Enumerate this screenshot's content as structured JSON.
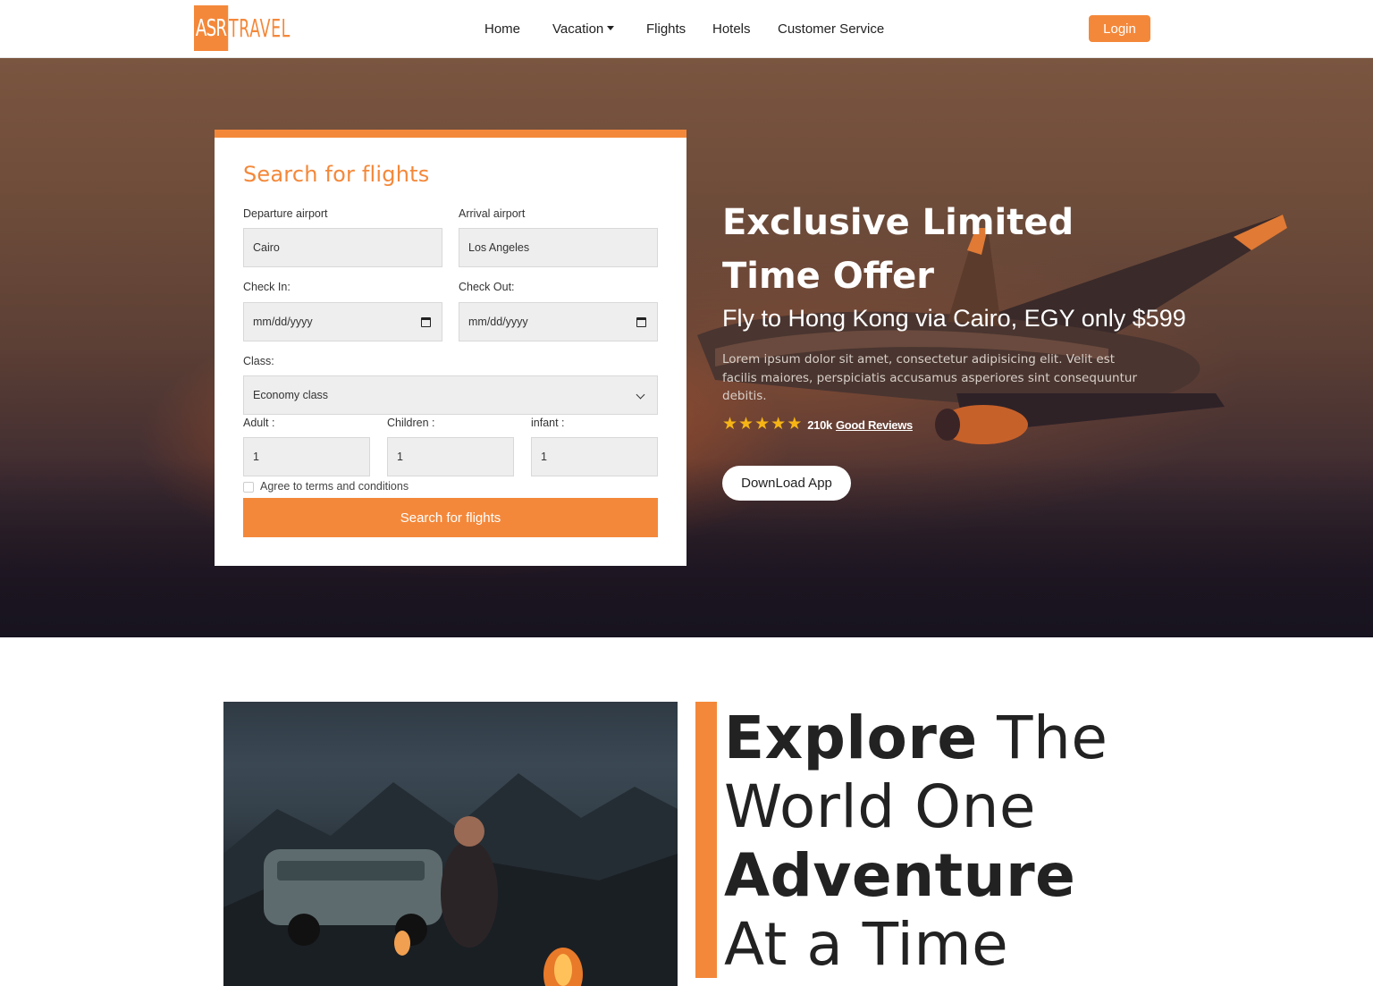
{
  "brand": {
    "logo_box": "ASR",
    "logo_text": "TRAVEL"
  },
  "nav": {
    "items": [
      "Home",
      "Vacation",
      "Flights",
      "Hotels",
      "Customer Service"
    ],
    "login": "Login"
  },
  "search_card": {
    "title": "Search for flights",
    "departure_label": "Departure airport",
    "departure_value": "Cairo",
    "arrival_label": "Arrival airport",
    "arrival_value": "Los Angeles",
    "checkin_label": "Check In:",
    "checkin_placeholder": "mm/dd/yyyy",
    "checkout_label": "Check Out:",
    "checkout_placeholder": "mm/dd/yyyy",
    "class_label": "Class:",
    "class_value": "Economy class",
    "adult_label": "Adult :",
    "adult_value": "1",
    "children_label": "Children :",
    "children_value": "1",
    "infant_label": "infant :",
    "infant_value": "1",
    "terms_label": "Agree to terms and conditions",
    "terms_checked": false,
    "submit": "Search for flights"
  },
  "hero": {
    "title": "Exclusive Limited Time Offer",
    "subtitle": "Fly to Hong Kong via Cairo, EGY only $599",
    "description": "Lorem ipsum dolor sit amet, consectetur adipisicing elit. Velit est facilis maiores, perspiciatis accusamus asperiores sint consequuntur debitis.",
    "rating_stars": 5,
    "reviews_count": "210k",
    "reviews_link": "Good Reviews",
    "download_button": "DownLoad App"
  },
  "explore": {
    "line1_bold": "Explore",
    "line1_rest": " The",
    "line2": "World One",
    "line3": "Adventure",
    "line4": "At a Time"
  },
  "colors": {
    "accent": "#f4883a",
    "star": "#f7b515"
  }
}
